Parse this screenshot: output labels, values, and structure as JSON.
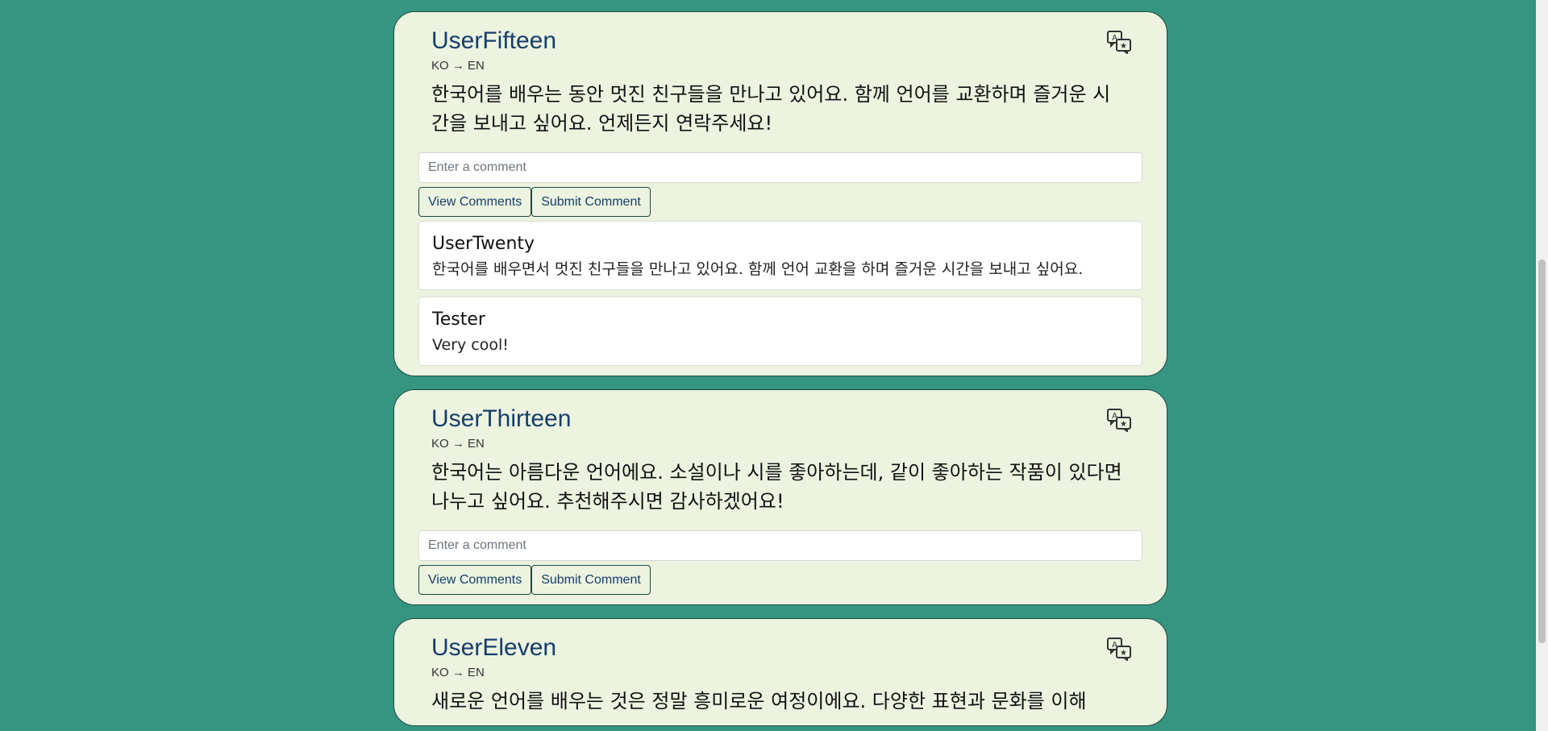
{
  "posts": [
    {
      "author": "UserFifteen",
      "lang": "KO → EN",
      "text": "한국어를 배우는 동안 멋진 친구들을 만나고 있어요. 함께 언어를 교환하며 즐거운 시간을 보내고 싶어요. 언제든지 연락주세요!",
      "comment_placeholder": "Enter a comment",
      "view_comments_label": "View Comments",
      "submit_comment_label": "Submit Comment",
      "comments": [
        {
          "author": "UserTwenty",
          "text": "한국어를 배우면서 멋진 친구들을 만나고 있어요. 함께 언어 교환을 하며 즐거운 시간을 보내고 싶어요."
        },
        {
          "author": "Tester",
          "text": "Very cool!"
        }
      ]
    },
    {
      "author": "UserThirteen",
      "lang": "KO → EN",
      "text": "한국어는 아름다운 언어에요. 소설이나 시를 좋아하는데, 같이 좋아하는 작품이 있다면 나누고 싶어요. 추천해주시면 감사하겠어요!",
      "comment_placeholder": "Enter a comment",
      "view_comments_label": "View Comments",
      "submit_comment_label": "Submit Comment"
    },
    {
      "author": "UserEleven",
      "lang": "KO → EN",
      "text": "새로운 언어를 배우는 것은 정말 흥미로운 여정이에요. 다양한 표현과 문화를 이해"
    }
  ],
  "icons": {
    "translate": "translate-icon"
  },
  "colors": {
    "background": "#369581",
    "card": "#ecf3df",
    "author": "#153e6b"
  }
}
